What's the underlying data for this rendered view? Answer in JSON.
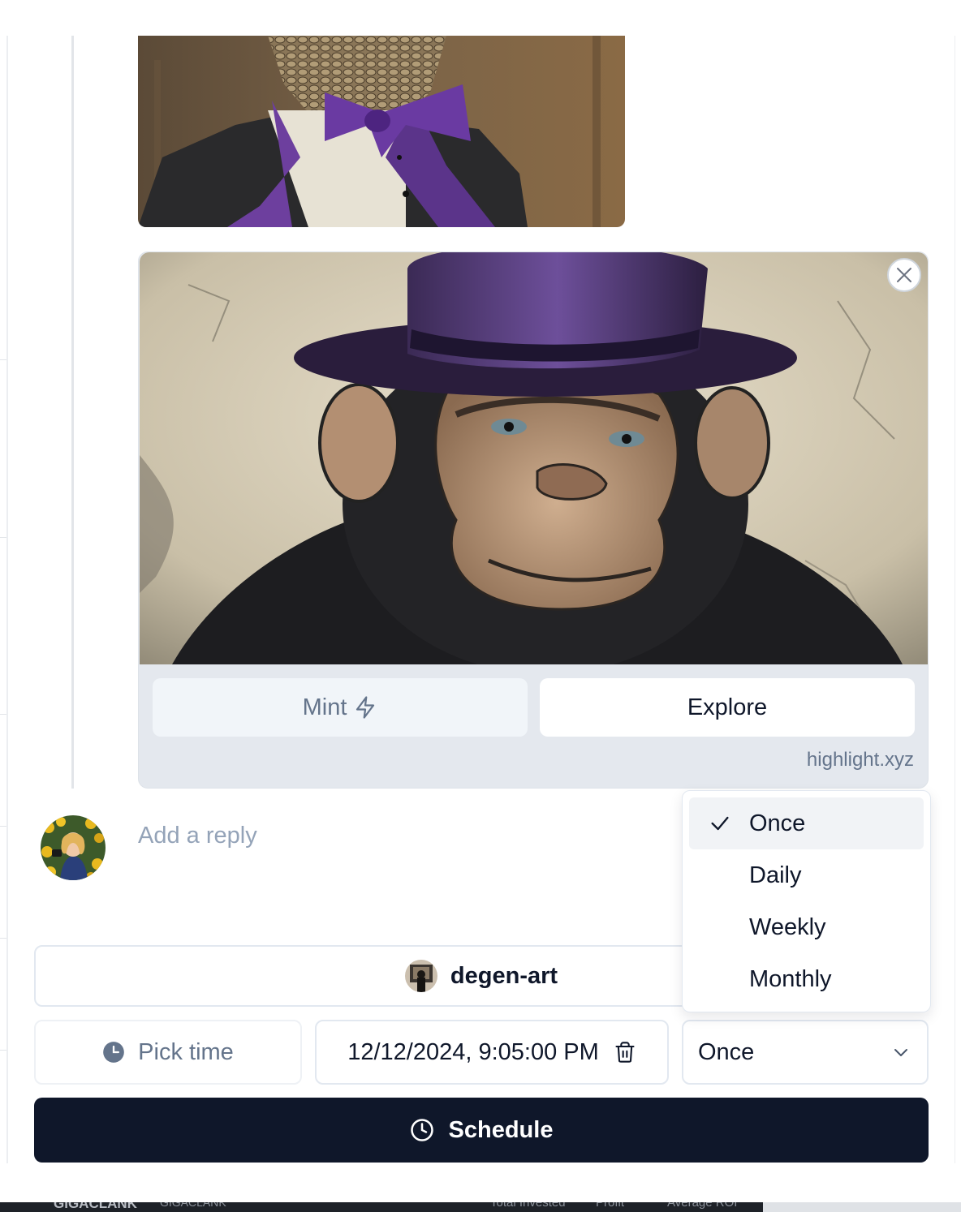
{
  "embed": {
    "mint_label": "Mint",
    "explore_label": "Explore",
    "domain": "highlight.xyz"
  },
  "reply": {
    "placeholder": "Add a reply"
  },
  "channel": {
    "name": "degen-art"
  },
  "schedule": {
    "pick_time_label": "Pick time",
    "datetime_value": "12/12/2024, 9:05:00 PM",
    "frequency_value": "Once",
    "button_label": "Schedule"
  },
  "frequency_options": [
    {
      "label": "Once",
      "selected": true
    },
    {
      "label": "Daily",
      "selected": false
    },
    {
      "label": "Weekly",
      "selected": false
    },
    {
      "label": "Monthly",
      "selected": false
    }
  ],
  "background_strip": {
    "texts": [
      "GIGACLANK",
      "GIGACLANK",
      "Total Invested",
      "Profit",
      "Average ROI"
    ]
  },
  "colors": {
    "primary": "#0f172a",
    "muted_text": "#64748b",
    "placeholder": "#94a3b8",
    "border": "#e2e8f0",
    "embed_bg": "#e4e8ee"
  }
}
